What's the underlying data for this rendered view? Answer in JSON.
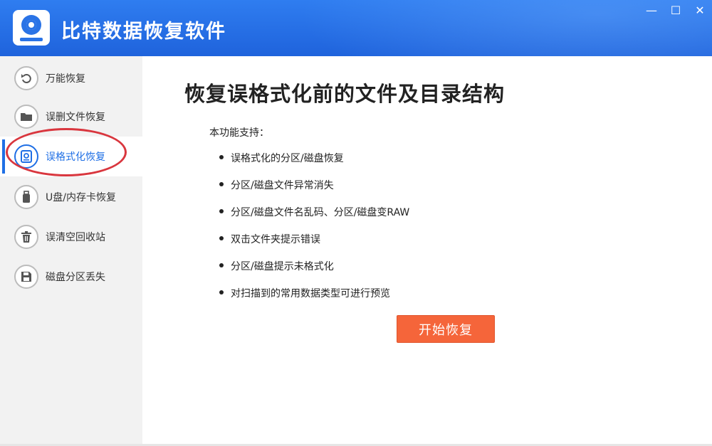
{
  "app": {
    "title": "比特数据恢复软件",
    "window_controls": {
      "minimize": "—",
      "maximize": "☐",
      "close": "✕"
    }
  },
  "sidebar": {
    "items": [
      {
        "label": "万能恢复",
        "icon": "undo-icon",
        "active": false
      },
      {
        "label": "误删文件恢复",
        "icon": "folder-icon",
        "active": false
      },
      {
        "label": "误格式化恢复",
        "icon": "disk-icon",
        "active": true
      },
      {
        "label": "U盘/内存卡恢复",
        "icon": "usb-icon",
        "active": false
      },
      {
        "label": "误清空回收站",
        "icon": "trash-icon",
        "active": false
      },
      {
        "label": "磁盘分区丢失",
        "icon": "save-icon",
        "active": false
      }
    ]
  },
  "main": {
    "heading": "恢复误格式化前的文件及目录结构",
    "support_title": "本功能支持：",
    "features": [
      "误格式化的分区/磁盘恢复",
      "分区/磁盘文件异常消失",
      "分区/磁盘文件名乱码、分区/磁盘变RAW",
      "双击文件夹提示错误",
      "分区/磁盘提示未格式化",
      "对扫描到的常用数据类型可进行预览"
    ],
    "start_button": "开始恢复"
  },
  "colors": {
    "titlebar": "#1f63dc",
    "accent": "#1f6fe5",
    "start_button": "#f5653a",
    "annotation_circle": "#d9363e",
    "sidebar_bg": "#f2f2f2"
  }
}
